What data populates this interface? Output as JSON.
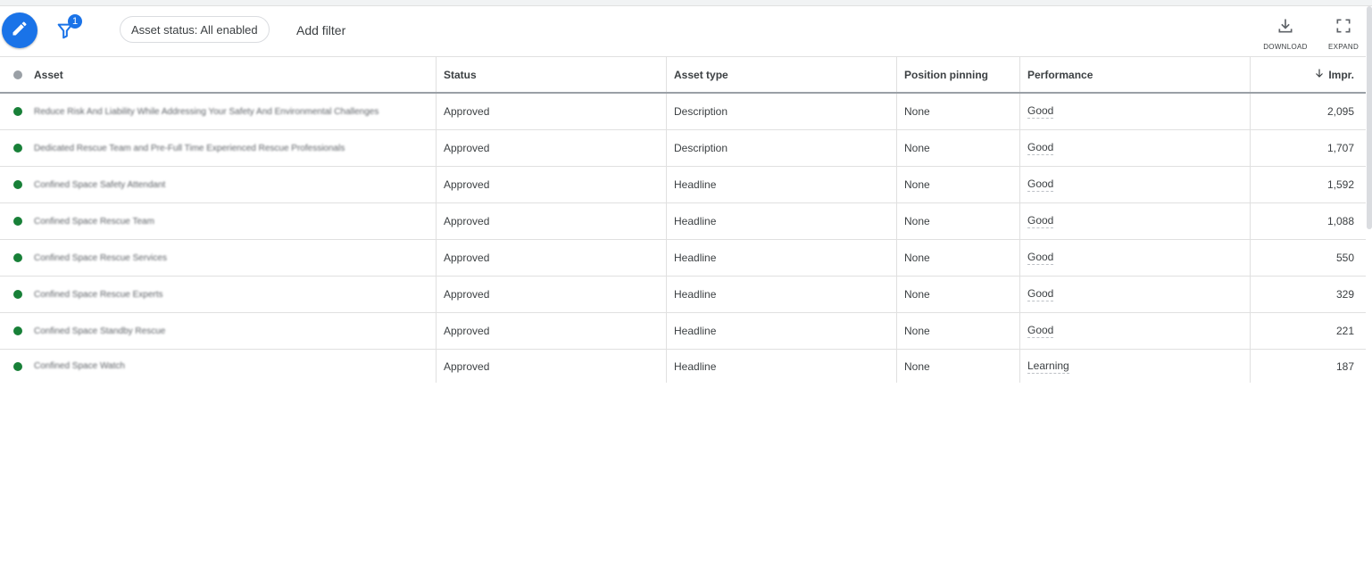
{
  "toolbar": {
    "filter_count": "1",
    "chip_label": "Asset status: All enabled",
    "add_filter_label": "Add filter",
    "download_label": "DOWNLOAD",
    "expand_label": "EXPAND"
  },
  "colors": {
    "accent": "#1a73e8",
    "status_enabled": "#188038",
    "header_dot": "#9aa0a6"
  },
  "table": {
    "headers": {
      "asset": "Asset",
      "status": "Status",
      "type": "Asset type",
      "pinning": "Position pinning",
      "performance": "Performance",
      "impr": "Impr."
    },
    "rows": [
      {
        "asset": "Reduce Risk And Liability While Addressing Your Safety And Environmental Challenges",
        "status": "Approved",
        "type": "Description",
        "pinning": "None",
        "performance": "Good",
        "impr": "2,095"
      },
      {
        "asset": "Dedicated Rescue Team and Pre-Full Time Experienced Rescue Professionals",
        "status": "Approved",
        "type": "Description",
        "pinning": "None",
        "performance": "Good",
        "impr": "1,707"
      },
      {
        "asset": "Confined Space Safety Attendant",
        "status": "Approved",
        "type": "Headline",
        "pinning": "None",
        "performance": "Good",
        "impr": "1,592"
      },
      {
        "asset": "Confined Space Rescue Team",
        "status": "Approved",
        "type": "Headline",
        "pinning": "None",
        "performance": "Good",
        "impr": "1,088"
      },
      {
        "asset": "Confined Space Rescue Services",
        "status": "Approved",
        "type": "Headline",
        "pinning": "None",
        "performance": "Good",
        "impr": "550"
      },
      {
        "asset": "Confined Space Rescue Experts",
        "status": "Approved",
        "type": "Headline",
        "pinning": "None",
        "performance": "Good",
        "impr": "329"
      },
      {
        "asset": "Confined Space Standby Rescue",
        "status": "Approved",
        "type": "Headline",
        "pinning": "None",
        "performance": "Good",
        "impr": "221"
      },
      {
        "asset": "Confined Space Watch",
        "status": "Approved",
        "type": "Headline",
        "pinning": "None",
        "performance": "Learning",
        "impr": "187"
      }
    ]
  }
}
